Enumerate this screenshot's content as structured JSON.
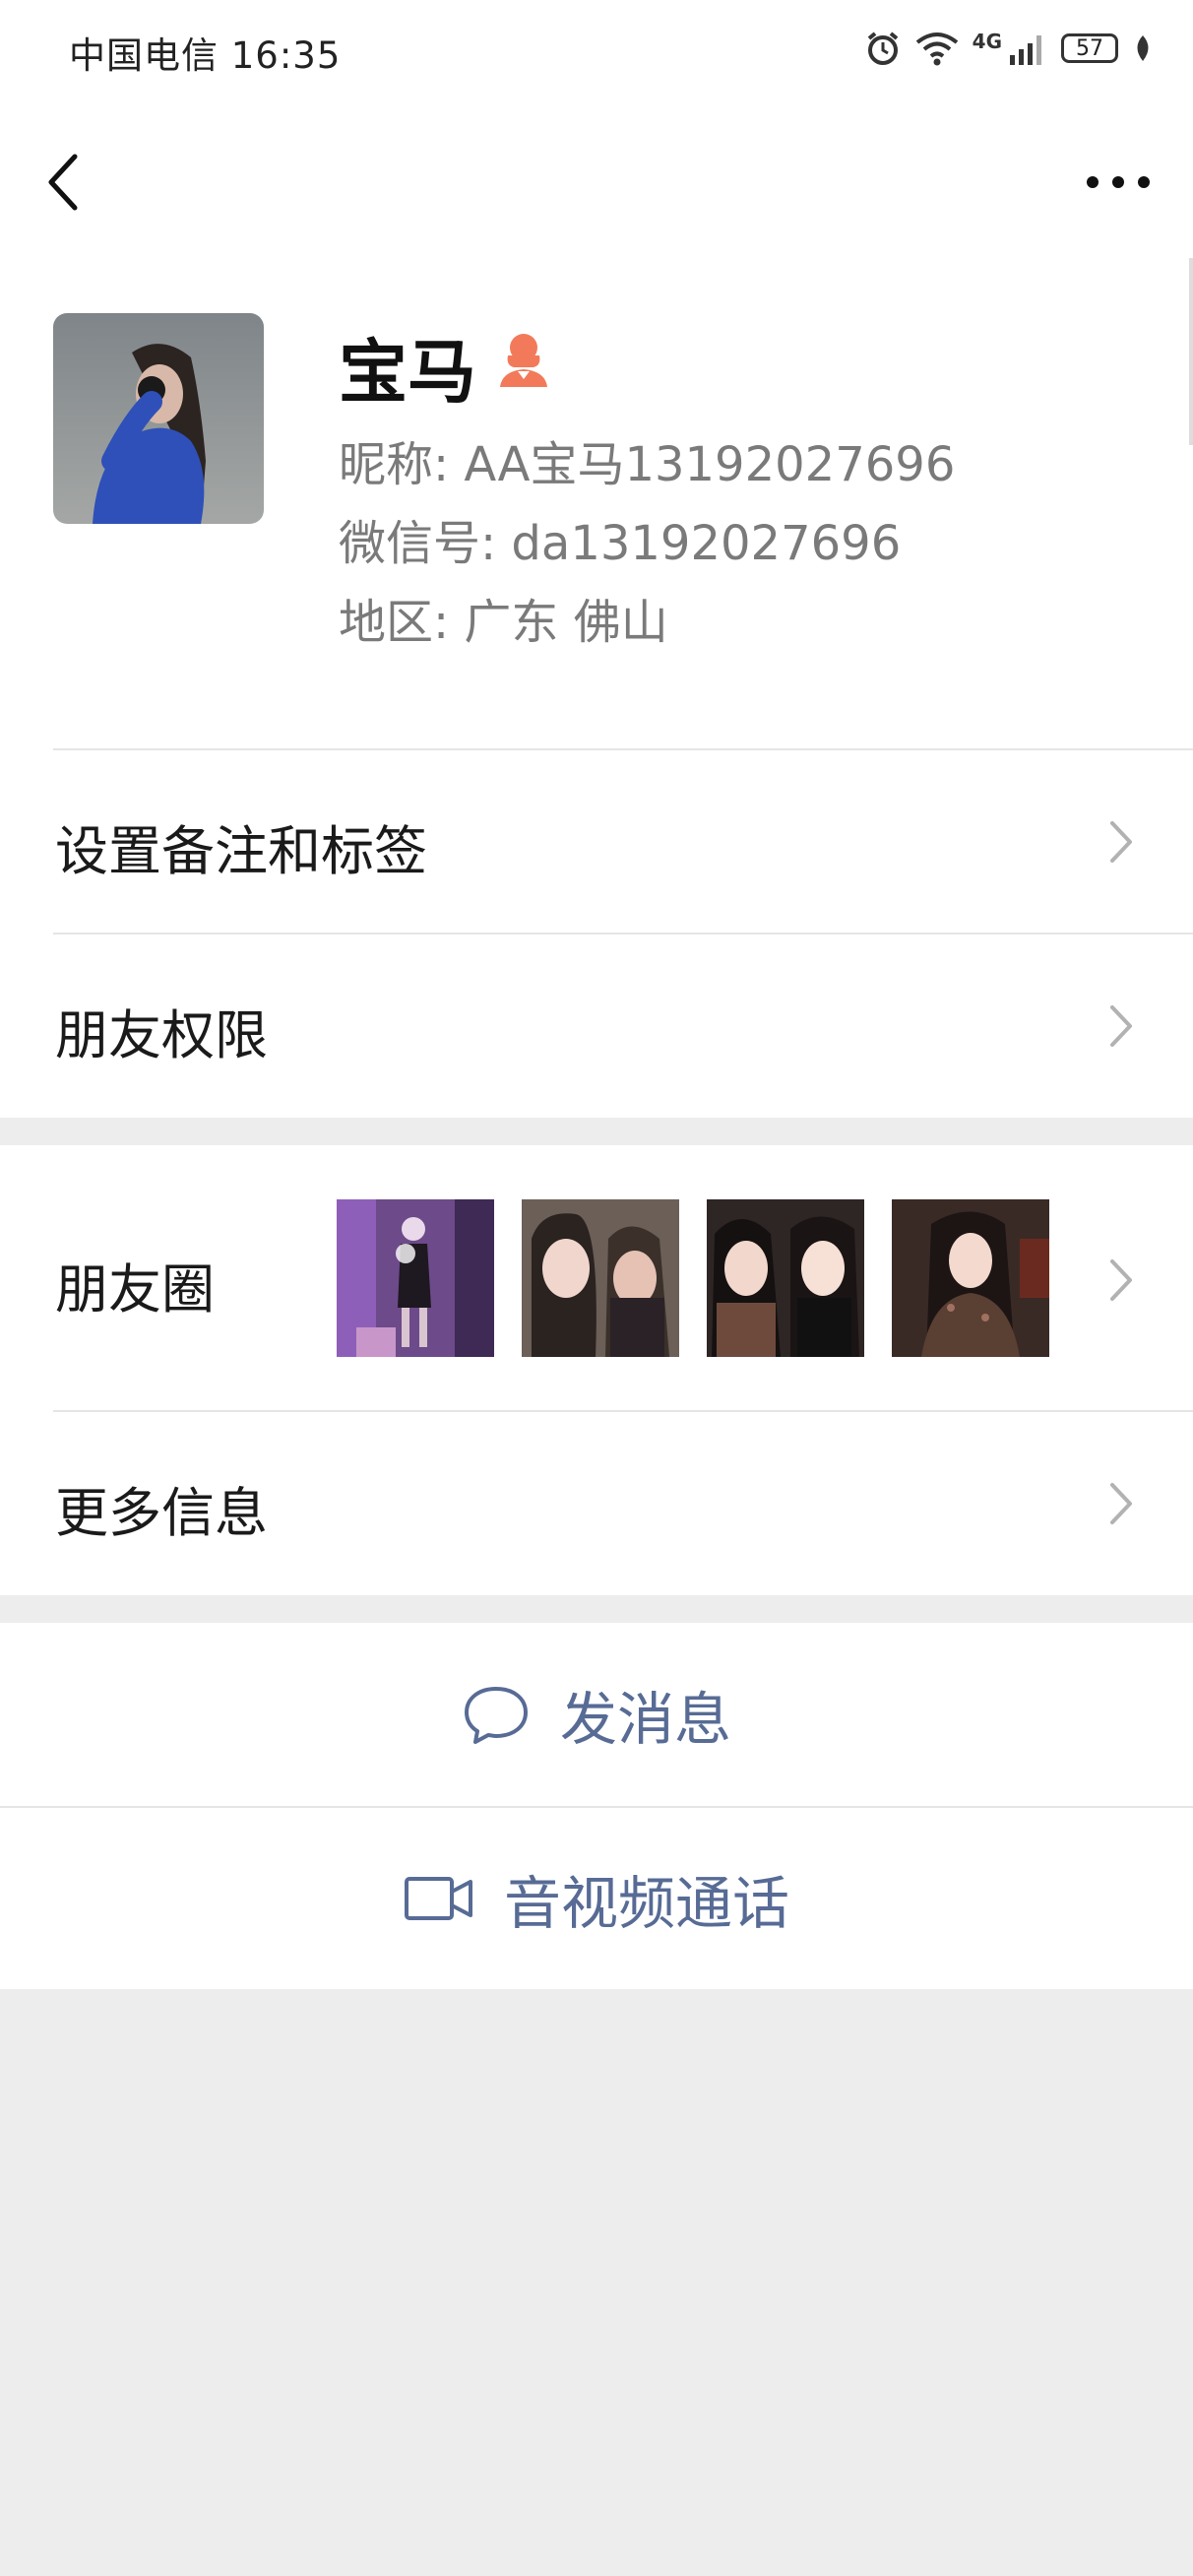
{
  "status_bar": {
    "carrier_time": "中国电信 16:35",
    "network": "4G",
    "battery": "57"
  },
  "profile": {
    "name": "宝马",
    "nickname": "昵称: AA宝马13192027696",
    "wechat_id": "微信号: da13192027696",
    "region": "地区: 广东  佛山"
  },
  "menu": {
    "remarks": "设置备注和标签",
    "permissions": "朋友权限",
    "moments": "朋友圈",
    "more_info": "更多信息"
  },
  "actions": {
    "message": "发消息",
    "video_call": "音视频通话"
  },
  "colors": {
    "link_blue": "#576b95",
    "gender_orange": "#f27a5a",
    "background": "#ededed"
  }
}
